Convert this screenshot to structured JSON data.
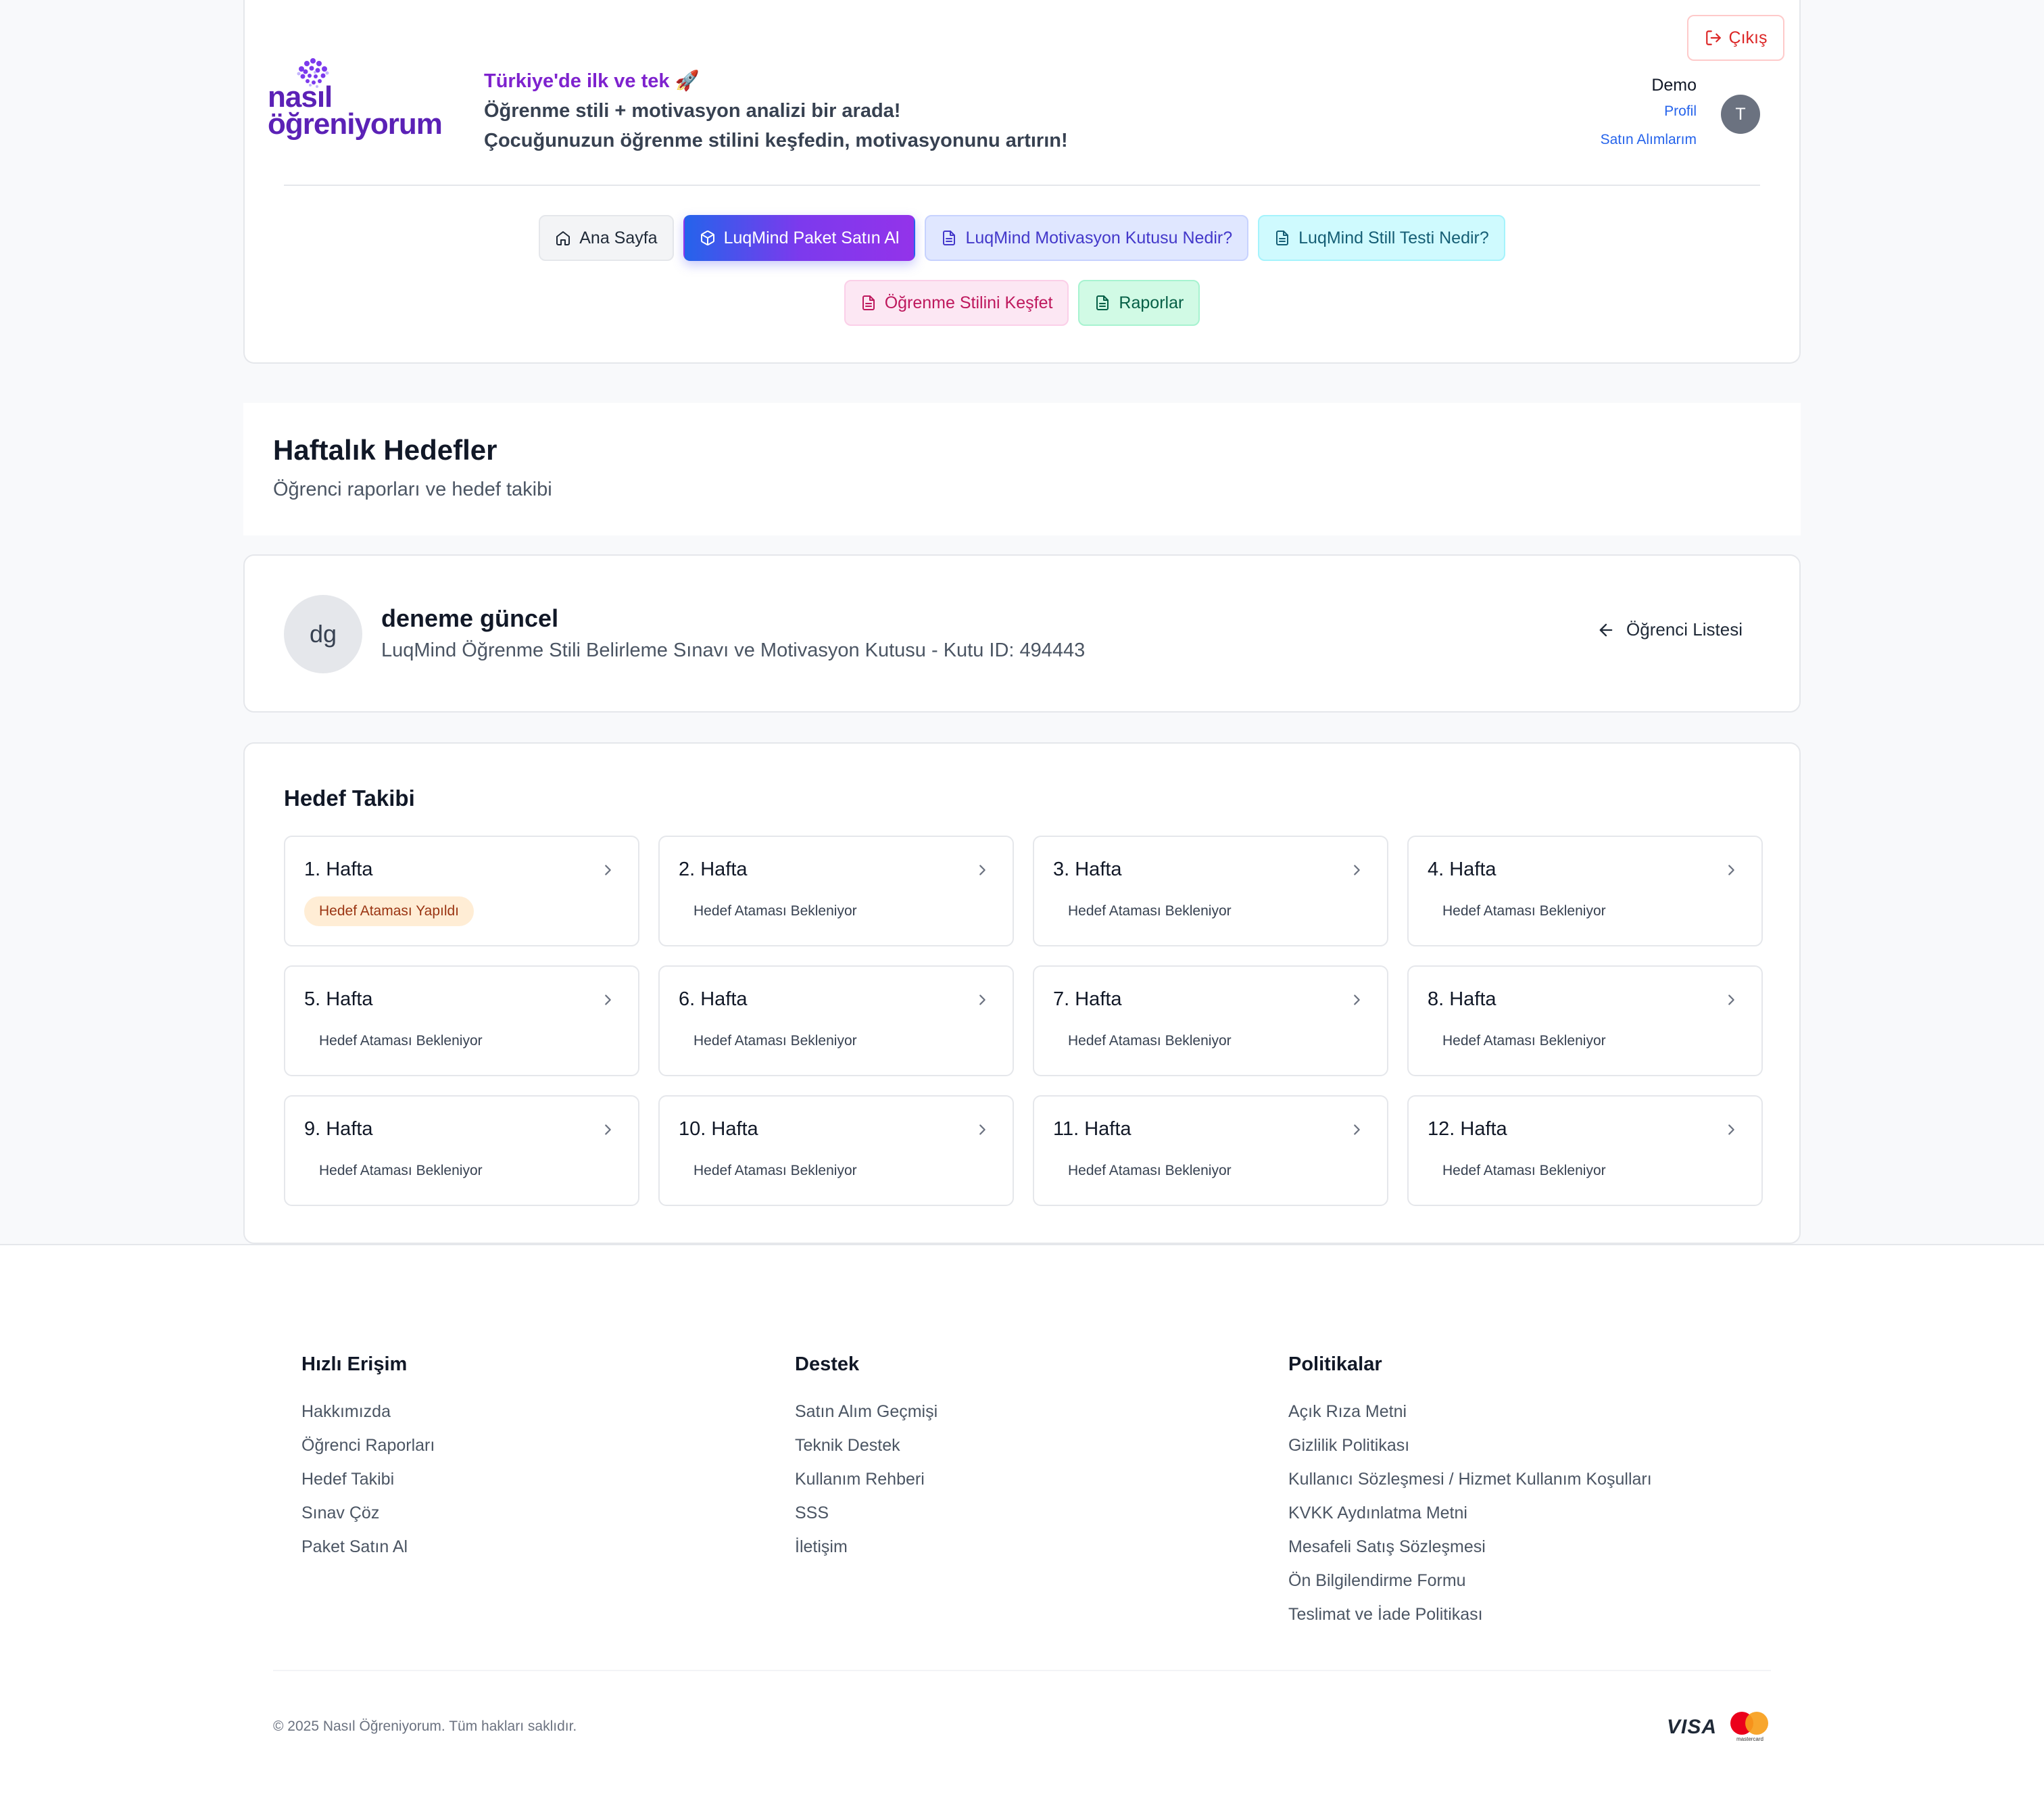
{
  "header": {
    "logo": {
      "line1": "nasıl",
      "line2": "öğreniyorum"
    },
    "tagline": {
      "line1": "Türkiye'de ilk ve tek 🚀",
      "line2": "Öğrenme stili + motivasyon analizi bir arada!",
      "line3": "Çocuğunuzun öğrenme stilini keşfedin, motivasyonunu artırın!"
    },
    "logout_label": "Çıkış",
    "user": {
      "name": "Demo",
      "profile_link": "Profil",
      "purchases_link": "Satın Alımlarım",
      "avatar_initial": "T"
    },
    "nav": {
      "home": "Ana Sayfa",
      "buy_package": "LuqMind Paket Satın Al",
      "motivation_box": "LuqMind Motivasyon Kutusu Nedir?",
      "still_test": "LuqMind Still Testi Nedir?",
      "discover_style": "Öğrenme Stilini Keşfet",
      "reports": "Raporlar"
    }
  },
  "page": {
    "title": "Haftalık Hedefler",
    "subtitle": "Öğrenci raporları ve hedef takibi"
  },
  "student": {
    "initials": "dg",
    "name": "deneme güncel",
    "description": "LuqMind Öğrenme Stili Belirleme Sınavı ve Motivasyon Kutusu - Kutu ID: 494443",
    "back_label": "Öğrenci Listesi"
  },
  "goals": {
    "title": "Hedef Takibi",
    "weeks": [
      {
        "label": "1. Hafta",
        "status": "Hedef Ataması Yapıldı"
      },
      {
        "label": "2. Hafta",
        "status": "Hedef Ataması Bekleniyor"
      },
      {
        "label": "3. Hafta",
        "status": "Hedef Ataması Bekleniyor"
      },
      {
        "label": "4. Hafta",
        "status": "Hedef Ataması Bekleniyor"
      },
      {
        "label": "5. Hafta",
        "status": "Hedef Ataması Bekleniyor"
      },
      {
        "label": "6. Hafta",
        "status": "Hedef Ataması Bekleniyor"
      },
      {
        "label": "7. Hafta",
        "status": "Hedef Ataması Bekleniyor"
      },
      {
        "label": "8. Hafta",
        "status": "Hedef Ataması Bekleniyor"
      },
      {
        "label": "9. Hafta",
        "status": "Hedef Ataması Bekleniyor"
      },
      {
        "label": "10. Hafta",
        "status": "Hedef Ataması Bekleniyor"
      },
      {
        "label": "11. Hafta",
        "status": "Hedef Ataması Bekleniyor"
      },
      {
        "label": "12. Hafta",
        "status": "Hedef Ataması Bekleniyor"
      }
    ]
  },
  "footer": {
    "quick_access": {
      "title": "Hızlı Erişim",
      "links": [
        "Hakkımızda",
        "Öğrenci Raporları",
        "Hedef Takibi",
        "Sınav Çöz",
        "Paket Satın Al"
      ]
    },
    "support": {
      "title": "Destek",
      "links": [
        "Satın Alım Geçmişi",
        "Teknik Destek",
        "Kullanım Rehberi",
        "SSS",
        "İletişim"
      ]
    },
    "policies": {
      "title": "Politikalar",
      "links": [
        "Açık Rıza Metni",
        "Gizlilik Politikası",
        "Kullanıcı Sözleşmesi / Hizmet Kullanım Koşulları",
        "KVKK Aydınlatma Metni",
        "Mesafeli Satış Sözleşmesi",
        "Ön Bilgilendirme Formu",
        "Teslimat ve İade Politikası"
      ]
    },
    "copyright": "© 2025 Nasıl Öğreniyorum. Tüm hakları saklıdır.",
    "payment": {
      "visa": "VISA",
      "mastercard": "mastercard"
    }
  },
  "colors": {
    "brand_purple": "#5b21b6",
    "accent_blue": "#2563eb",
    "logout_red": "#dc2626",
    "done_badge_bg": "#ffedd5"
  }
}
